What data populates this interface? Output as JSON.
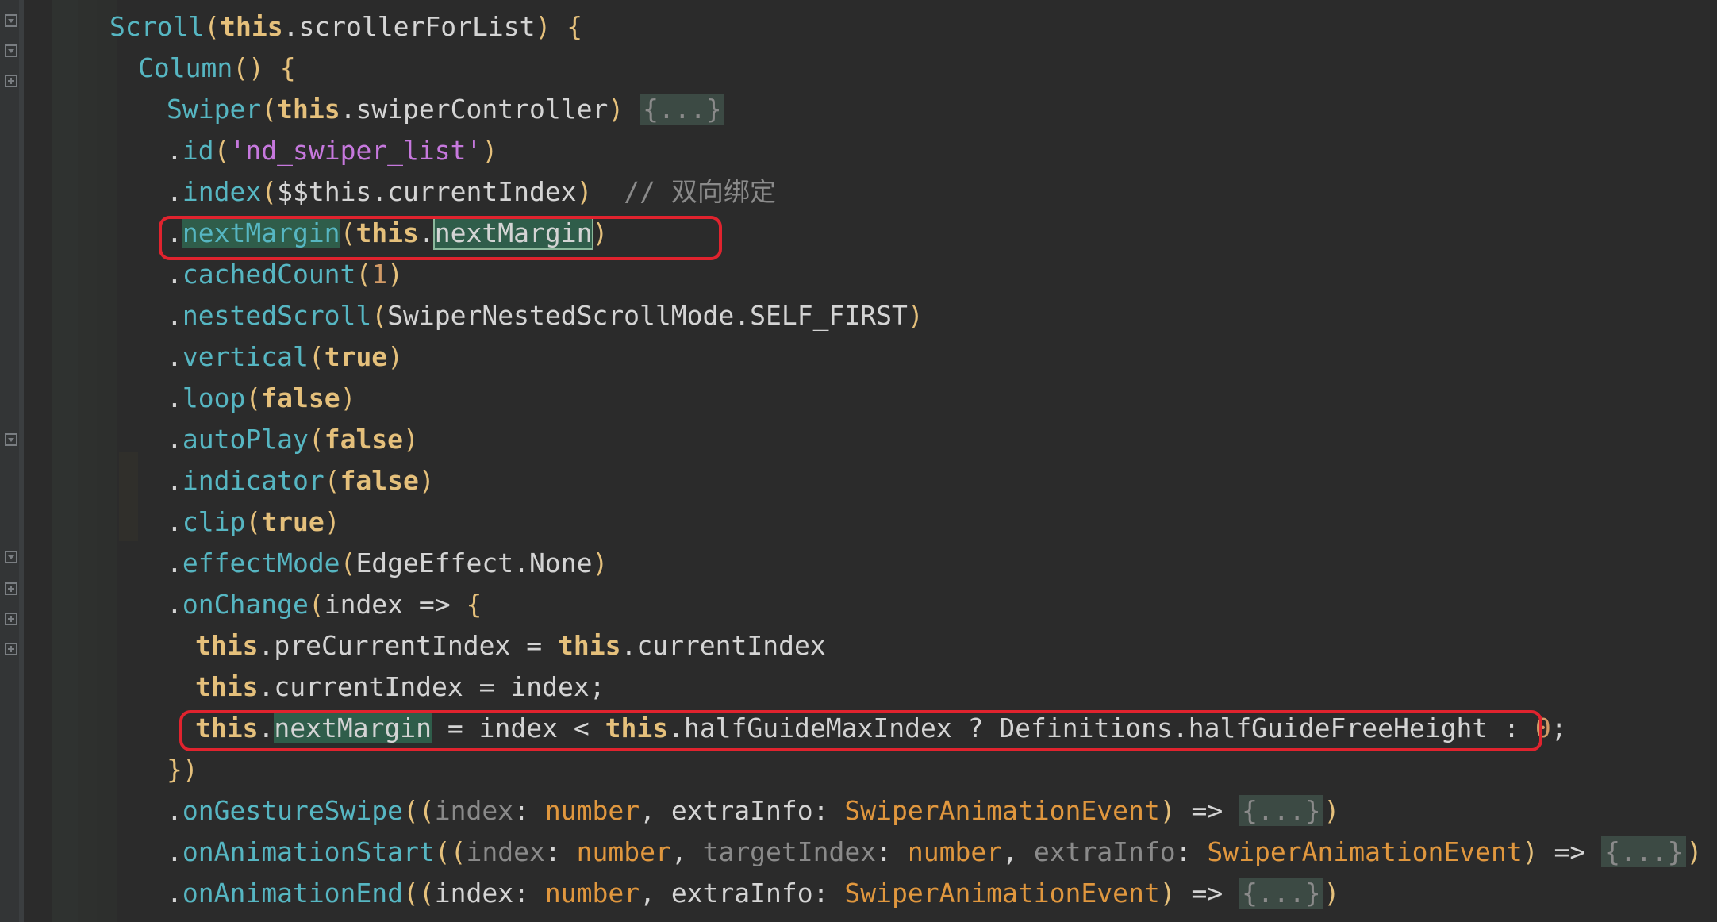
{
  "editor": {
    "lines": [
      [
        [
          "fn",
          "Scroll"
        ],
        [
          "br",
          "("
        ],
        [
          "kw",
          "this"
        ],
        [
          "pl",
          ".scrollerForList"
        ],
        [
          "br",
          ")"
        ],
        [
          "pl",
          " "
        ],
        [
          "br",
          "{"
        ]
      ],
      [
        [
          "fn",
          "Column"
        ],
        [
          "br",
          "()"
        ],
        [
          "pl",
          " "
        ],
        [
          "br",
          "{"
        ]
      ],
      [
        [
          "fn",
          "Swiper"
        ],
        [
          "br",
          "("
        ],
        [
          "kw",
          "this"
        ],
        [
          "pl",
          ".swiperController"
        ],
        [
          "br",
          ")"
        ],
        [
          "pl",
          " "
        ],
        [
          "fold",
          "{...}"
        ]
      ],
      [
        [
          "pl",
          "."
        ],
        [
          "fn",
          "id"
        ],
        [
          "br",
          "("
        ],
        [
          "str",
          "'nd_swiper_list'"
        ],
        [
          "br",
          ")"
        ]
      ],
      [
        [
          "pl",
          "."
        ],
        [
          "fn",
          "index"
        ],
        [
          "br",
          "("
        ],
        [
          "pl",
          "$$this.currentIndex"
        ],
        [
          "br",
          ")"
        ],
        [
          "pl",
          "  "
        ],
        [
          "cm",
          "// 双向绑定"
        ]
      ],
      [
        [
          "pl",
          "."
        ],
        [
          "fnhl",
          "nextMargin"
        ],
        [
          "br",
          "("
        ],
        [
          "kw",
          "this"
        ],
        [
          "pl",
          "."
        ],
        [
          "hlbox",
          "nextMargin"
        ],
        [
          "br",
          ")"
        ]
      ],
      [
        [
          "pl",
          "."
        ],
        [
          "fn",
          "cachedCount"
        ],
        [
          "br",
          "("
        ],
        [
          "num",
          "1"
        ],
        [
          "br",
          ")"
        ]
      ],
      [
        [
          "pl",
          "."
        ],
        [
          "fn",
          "nestedScroll"
        ],
        [
          "br",
          "("
        ],
        [
          "pl",
          "SwiperNestedScrollMode.SELF_FIRST"
        ],
        [
          "br",
          ")"
        ]
      ],
      [
        [
          "pl",
          "."
        ],
        [
          "fn",
          "vertical"
        ],
        [
          "br",
          "("
        ],
        [
          "kw",
          "true"
        ],
        [
          "br",
          ")"
        ]
      ],
      [
        [
          "pl",
          "."
        ],
        [
          "fn",
          "loop"
        ],
        [
          "br",
          "("
        ],
        [
          "kw",
          "false"
        ],
        [
          "br",
          ")"
        ]
      ],
      [
        [
          "pl",
          "."
        ],
        [
          "fn",
          "autoPlay"
        ],
        [
          "br",
          "("
        ],
        [
          "kw",
          "false"
        ],
        [
          "br",
          ")"
        ]
      ],
      [
        [
          "pl",
          "."
        ],
        [
          "fn",
          "indicator"
        ],
        [
          "br",
          "("
        ],
        [
          "kw",
          "false"
        ],
        [
          "br",
          ")"
        ]
      ],
      [
        [
          "pl",
          "."
        ],
        [
          "fn",
          "clip"
        ],
        [
          "br",
          "("
        ],
        [
          "kw",
          "true"
        ],
        [
          "br",
          ")"
        ]
      ],
      [
        [
          "pl",
          "."
        ],
        [
          "fn",
          "effectMode"
        ],
        [
          "br",
          "("
        ],
        [
          "pl",
          "EdgeEffect.None"
        ],
        [
          "br",
          ")"
        ]
      ],
      [
        [
          "pl",
          "."
        ],
        [
          "fn",
          "onChange"
        ],
        [
          "br",
          "("
        ],
        [
          "pl",
          "index => "
        ],
        [
          "br",
          "{"
        ]
      ],
      [
        [
          "kw",
          "this"
        ],
        [
          "pl",
          ".preCurrentIndex = "
        ],
        [
          "kw",
          "this"
        ],
        [
          "pl",
          ".currentIndex"
        ]
      ],
      [
        [
          "kw",
          "this"
        ],
        [
          "pl",
          ".currentIndex = index;"
        ]
      ],
      [
        [
          "kw",
          "this"
        ],
        [
          "pl",
          "."
        ],
        [
          "hl",
          "nextMargin"
        ],
        [
          "pl",
          " = index < "
        ],
        [
          "kw",
          "this"
        ],
        [
          "pl",
          ".halfGuideMaxIndex ? Definitions.halfGuideFreeHeight : "
        ],
        [
          "num",
          "0"
        ],
        [
          "pl",
          ";"
        ]
      ],
      [
        [
          "br",
          "})"
        ]
      ],
      [
        [
          "pl",
          "."
        ],
        [
          "fn",
          "onGestureSwipe"
        ],
        [
          "br",
          "(("
        ],
        [
          "dim",
          "index"
        ],
        [
          "pl",
          ": "
        ],
        [
          "typ",
          "number"
        ],
        [
          "pl",
          ", extraInfo: "
        ],
        [
          "typ",
          "SwiperAnimationEvent"
        ],
        [
          "br",
          ")"
        ],
        [
          "pl",
          " => "
        ],
        [
          "fold",
          "{...}"
        ],
        [
          "br",
          ")"
        ]
      ],
      [
        [
          "pl",
          "."
        ],
        [
          "fn",
          "onAnimationStart"
        ],
        [
          "br",
          "(("
        ],
        [
          "dim",
          "index"
        ],
        [
          "pl",
          ": "
        ],
        [
          "typ",
          "number"
        ],
        [
          "pl",
          ", "
        ],
        [
          "dim",
          "targetIndex"
        ],
        [
          "pl",
          ": "
        ],
        [
          "typ",
          "number"
        ],
        [
          "pl",
          ", "
        ],
        [
          "dim",
          "extraInfo"
        ],
        [
          "pl",
          ": "
        ],
        [
          "typ",
          "SwiperAnimationEvent"
        ],
        [
          "br",
          ")"
        ],
        [
          "pl",
          " => "
        ],
        [
          "foldhl",
          "{...}"
        ],
        [
          "br",
          ")"
        ]
      ],
      [
        [
          "pl",
          "."
        ],
        [
          "fn",
          "onAnimationEnd"
        ],
        [
          "br",
          "(("
        ],
        [
          "pl",
          "index"
        ],
        [
          "pl",
          ": "
        ],
        [
          "typ",
          "number"
        ],
        [
          "pl",
          ", extraInfo: "
        ],
        [
          "typ",
          "SwiperAnimationEvent"
        ],
        [
          "br",
          ")"
        ],
        [
          "pl",
          " => "
        ],
        [
          "fold",
          "{...}"
        ],
        [
          "br",
          ")"
        ]
      ]
    ]
  },
  "colors": {
    "background": "#2b2b2b",
    "function": "#56b6c2",
    "keyword": "#e5c07b",
    "string": "#c678dd",
    "number": "#d19a66",
    "type": "#e0973e",
    "comment": "#8a8a8a",
    "highlight": "#2f5d4a",
    "annotation_box": "#e0232e"
  }
}
